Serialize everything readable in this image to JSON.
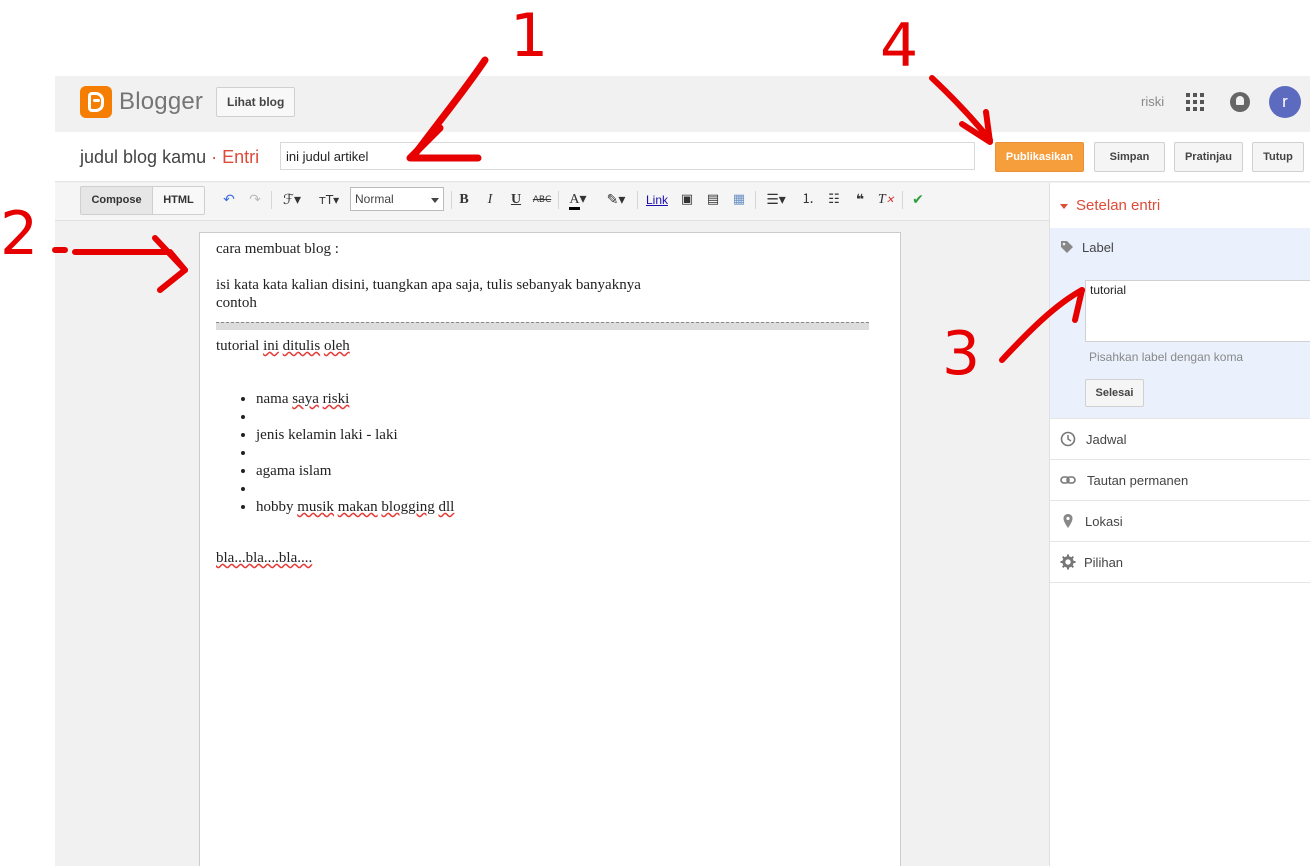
{
  "app": {
    "logo_text": "Blogger",
    "view_blog_label": "Lihat blog",
    "username": "riski",
    "avatar_letter": "r"
  },
  "post": {
    "blog_name": "judul blog kamu",
    "separator": "·",
    "section": "Entri",
    "title_value": "ini judul artikel"
  },
  "actions": {
    "publish": "Publikasikan",
    "save": "Simpan",
    "preview": "Pratinjau",
    "close": "Tutup"
  },
  "toolbar": {
    "compose": "Compose",
    "html": "HTML",
    "format_value": "Normal",
    "link": "Link"
  },
  "editor": {
    "line1": "cara membuat blog :",
    "line2": "isi kata kata kalian disini, tuangkan apa saja, tulis sebanyak banyaknya",
    "line3": "contoh",
    "line4_a": "tutorial ",
    "line4_b": "ini",
    "line4_c": " ",
    "line4_d": "ditulis",
    "line4_e": " ",
    "line4_f": "oleh",
    "bullet1_a": "nama ",
    "bullet1_b": "saya",
    "bullet1_c": " ",
    "bullet1_d": "riski",
    "bullet2": "jenis kelamin laki - laki",
    "bullet3": "agama islam",
    "bullet4_a": "hobby ",
    "bullet4_b": "musik",
    "bullet4_c": " ",
    "bullet4_d": "makan",
    "bullet4_e": " ",
    "bullet4_f": "blogging",
    "bullet4_g": " ",
    "bullet4_h": "dll",
    "closing": "bla...bla....bla...."
  },
  "sidebar": {
    "heading": "Setelan entri",
    "label_title": "Label",
    "label_value": "tutorial",
    "label_hint": "Pisahkan label dengan koma",
    "done": "Selesai",
    "items": [
      {
        "label": "Jadwal",
        "icon": "clock-icon"
      },
      {
        "label": "Tautan permanen",
        "icon": "link-icon"
      },
      {
        "label": "Lokasi",
        "icon": "location-icon"
      },
      {
        "label": "Pilihan",
        "icon": "gear-icon"
      }
    ]
  },
  "annotations": {
    "n1": "1",
    "n2": "2",
    "n3": "3",
    "n4": "4"
  },
  "colors": {
    "accent": "#dd4b39",
    "publish": "#f69d3c",
    "logo": "#f57d00",
    "annotation": "#e60000"
  }
}
